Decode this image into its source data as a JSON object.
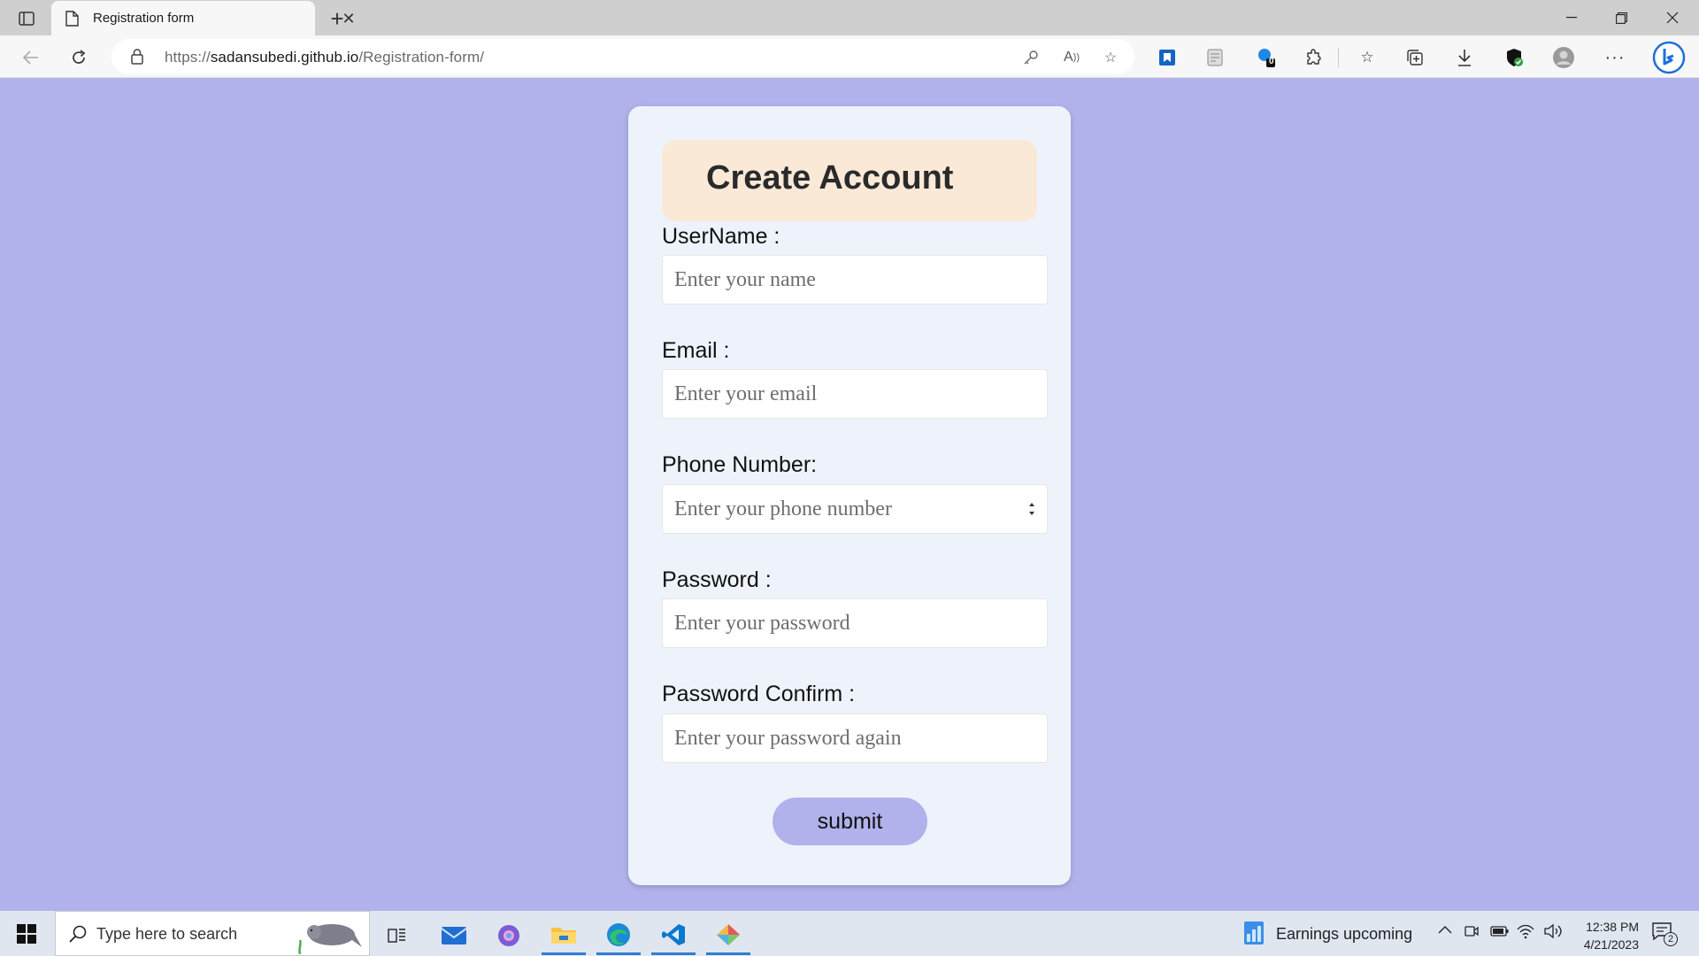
{
  "browser": {
    "tab_title": "Registration form",
    "url_scheme": "https://",
    "url_host": "sadansubedi.github.io",
    "url_path": "/Registration-form/"
  },
  "form": {
    "title": "Create Account",
    "fields": [
      {
        "label": "UserName :",
        "placeholder": "Enter your name"
      },
      {
        "label": "Email :",
        "placeholder": "Enter your email"
      },
      {
        "label": "Phone Number:",
        "placeholder": "Enter your phone number"
      },
      {
        "label": "Password :",
        "placeholder": "Enter your password"
      },
      {
        "label": "Password Confirm :",
        "placeholder": "Enter your password again"
      }
    ],
    "submit_label": "submit"
  },
  "taskbar": {
    "search_placeholder": "Type here to search",
    "widget_text": "Earnings upcoming",
    "time": "12:38 PM",
    "date": "4/21/2023",
    "notification_count": "2",
    "extension_badge": "0"
  },
  "colors": {
    "page_background": "#b1b1ec",
    "card_background": "#eef3fb",
    "header_background": "#fae9d7",
    "submit_background": "#b1b1ec"
  }
}
